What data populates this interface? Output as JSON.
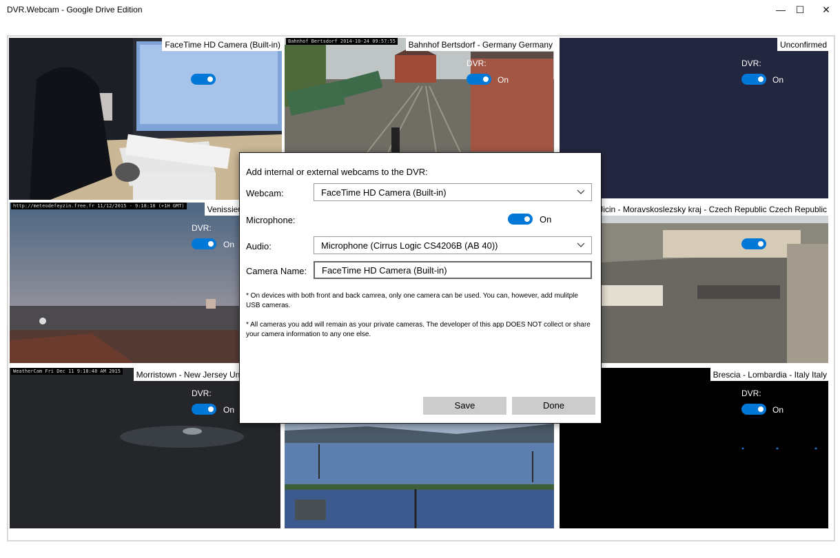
{
  "window": {
    "title": "DVR.Webcam - Google Drive Edition",
    "minimize_glyph": "—",
    "maximize_glyph": "☐",
    "close_glyph": "✕"
  },
  "colors": {
    "accent": "#0078d7",
    "button": "#cccccc"
  },
  "cameras": [
    {
      "name": "FaceTime HD Camera (Built-in)",
      "stamp": "",
      "dvr_label": "",
      "toggle_state": ""
    },
    {
      "name": "Bahnhof Bertsdorf - Germany Germany",
      "stamp": "Bahnhof Bertsdorf 2014-10-24 09:57:55",
      "dvr_label": "DVR:",
      "toggle_state": "On"
    },
    {
      "name": "Unconfirmed",
      "stamp": "",
      "dvr_label": "DVR:",
      "toggle_state": "On"
    },
    {
      "name": "Venissieux - France",
      "stamp": "http://meteodefeyzin.free.fr  11/12/2015 - 9:18:18 (+1H GMT)",
      "dvr_label": "DVR:",
      "toggle_state": "On"
    },
    {
      "name": "Novy Jicin - Moravskoslezsky kraj - Czech Republic Czech Republic",
      "stamp": "",
      "dvr_label": "",
      "toggle_state": ""
    },
    {
      "name": "Morristown - New Jersey United States",
      "stamp": "WeatherCam  Fri Dec 11   9:18:48 AM  2015",
      "dvr_label": "DVR:",
      "toggle_state": "On"
    },
    {
      "name": "",
      "stamp": "",
      "dvr_label": "",
      "toggle_state": ""
    },
    {
      "name": "Brescia - Lombardia - Italy Italy",
      "stamp": "",
      "dvr_label": "DVR:",
      "toggle_state": "On"
    }
  ],
  "dialog": {
    "heading": "Add internal or external webcams to the DVR:",
    "webcam_label": "Webcam:",
    "webcam_value": "FaceTime HD Camera (Built-in)",
    "microphone_label": "Microphone:",
    "microphone_state": "On",
    "audio_label": "Audio:",
    "audio_value": "Microphone (Cirrus Logic CS4206B (AB 40))",
    "camera_name_label": "Camera Name:",
    "camera_name_value": "FaceTime HD Camera (Built-in)",
    "note1": "* On devices with both front and back camrea, only one camera can be used.  You can, however, add mulitple USB cameras.",
    "note2": "* All cameras you add will remain as your private cameras.  The developer of this app DOES NOT collect or share your camera information to any one else.",
    "save_label": "Save",
    "done_label": "Done"
  }
}
